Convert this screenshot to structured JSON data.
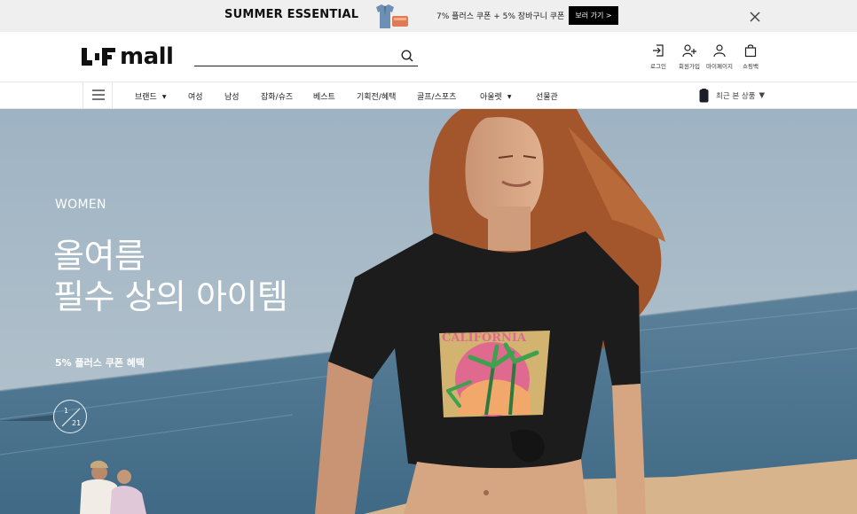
{
  "promo": {
    "title": "SUMMER ESSENTIAL",
    "coupon_text": "7% 플러스 쿠폰 + 5% 장바구니 쿠폰",
    "button_label": "보러 가기 >"
  },
  "header": {
    "logo_text": "mall",
    "search": {
      "value": "",
      "placeholder": ""
    },
    "utility": [
      {
        "label": "로그인",
        "icon": "login-icon"
      },
      {
        "label": "회원가입",
        "icon": "signup-icon"
      },
      {
        "label": "마이페이지",
        "icon": "mypage-icon"
      },
      {
        "label": "쇼핑백",
        "icon": "shopping-bag-icon"
      }
    ]
  },
  "nav": {
    "items": [
      {
        "label": "브랜드",
        "has_caret": true
      },
      {
        "label": "여성"
      },
      {
        "label": "남성"
      },
      {
        "label": "잡화/슈즈"
      },
      {
        "label": "베스트"
      },
      {
        "label": "기획전/혜택"
      },
      {
        "label": "골프/스포츠"
      },
      {
        "label": "아울렛",
        "has_caret": true
      },
      {
        "label": "선물관"
      }
    ],
    "recent_label": "최근 본 상품"
  },
  "hero": {
    "category": "WOMEN",
    "headline_line1": "올여름",
    "headline_line2": "필수 상의 아이템",
    "subtext": "5% 플러스 쿠폰 혜택",
    "shirt_text": "CALIFORNIA",
    "pager": {
      "current": "1",
      "total": "21"
    }
  },
  "colors": {
    "promo_bg": "#efefef",
    "button_bg": "#000000",
    "sky": "#9fb5c4",
    "sea": "#4f7891",
    "sand": "#d8b48c"
  }
}
